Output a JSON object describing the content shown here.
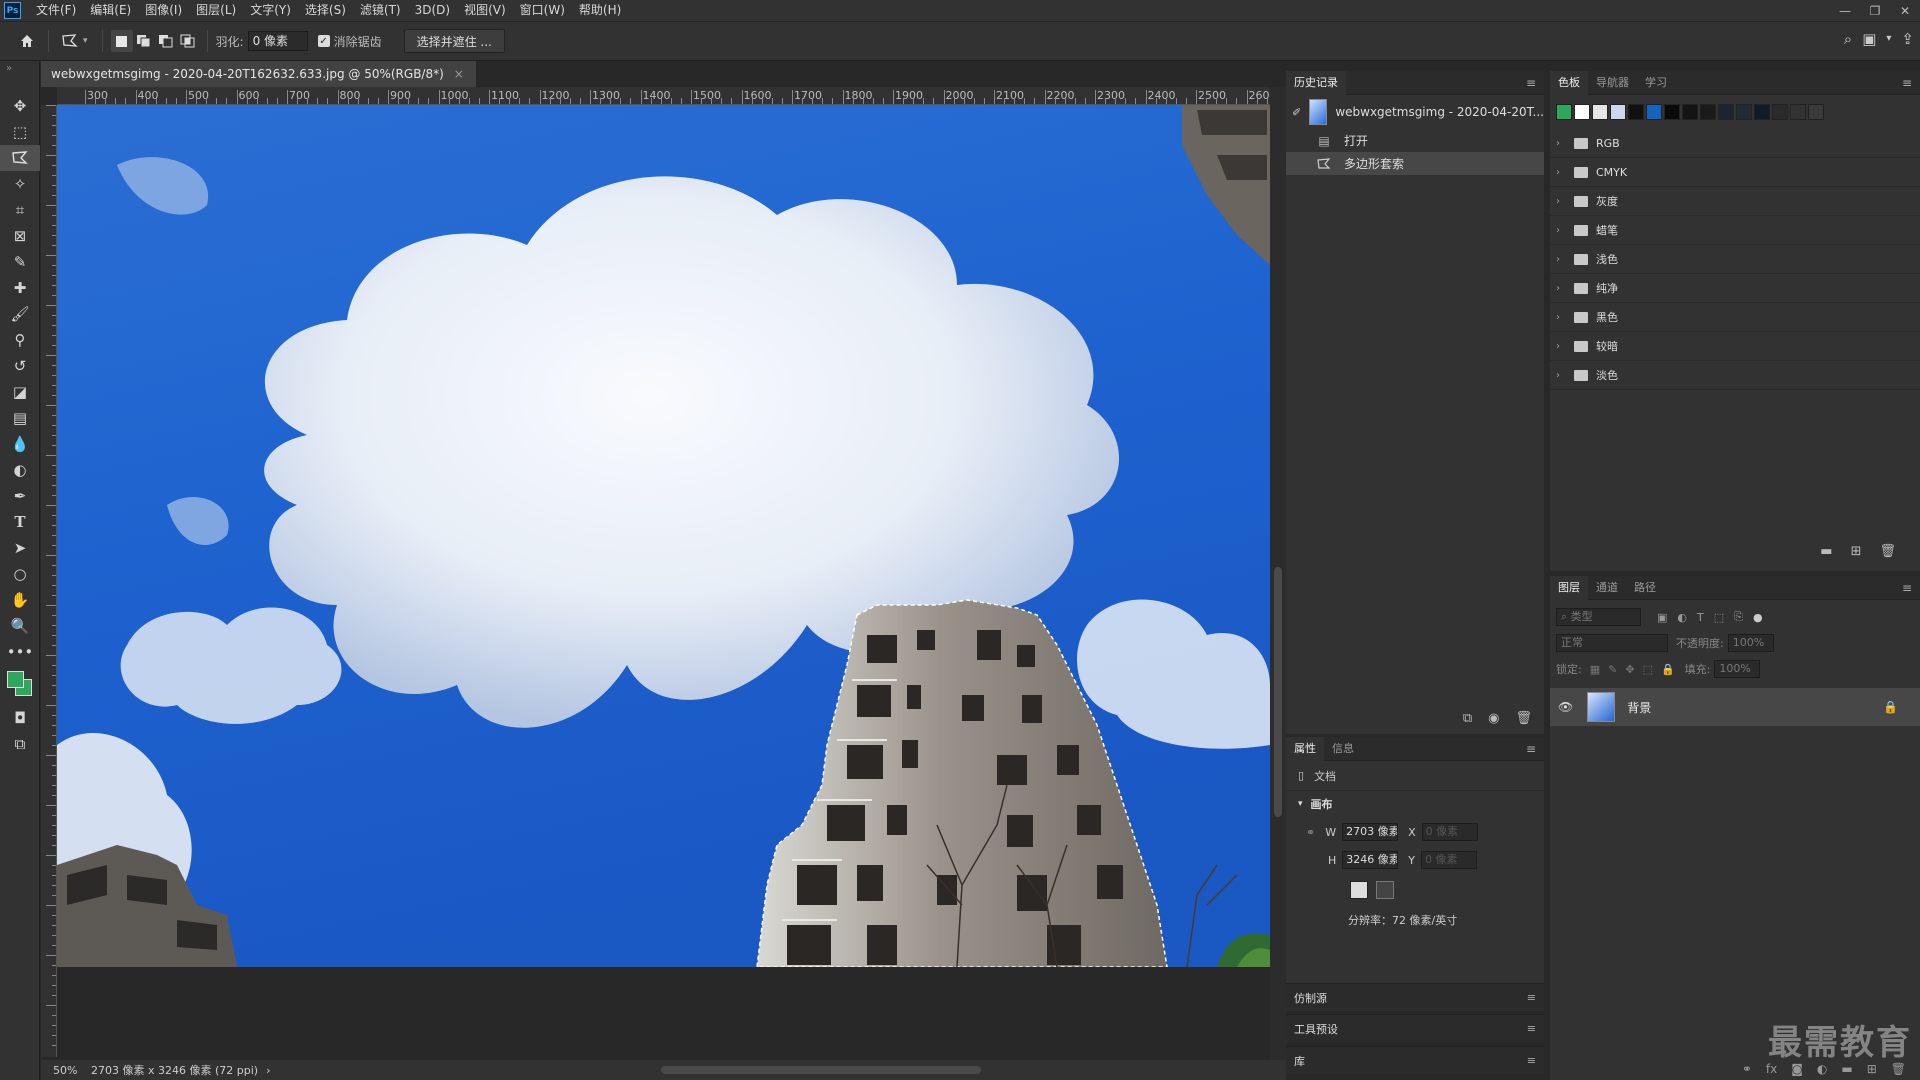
{
  "app": {
    "logo": "Ps",
    "menus": [
      "文件(F)",
      "编辑(E)",
      "图像(I)",
      "图层(L)",
      "文字(Y)",
      "选择(S)",
      "滤镜(T)",
      "3D(D)",
      "视图(V)",
      "窗口(W)",
      "帮助(H)"
    ]
  },
  "options": {
    "feather_label": "羽化:",
    "feather_value": "0 像素",
    "antialias_label": "消除锯齿",
    "select_mask_button": "选择并遮住 ..."
  },
  "document": {
    "tab_title": "webwxgetmsgimg - 2020-04-20T162632.633.jpg @ 50%(RGB/8*)",
    "tab_close": "×",
    "ruler_ticks": [
      "300",
      "400",
      "500",
      "600",
      "700",
      "800",
      "900",
      "1000",
      "1100",
      "1200",
      "1300",
      "1400",
      "1500",
      "1600",
      "1700",
      "1800",
      "1900",
      "2000",
      "2100",
      "2200",
      "2300",
      "2400",
      "2500",
      "260"
    ],
    "zoom": "50%",
    "status_info": "2703 像素 x 3246 像素 (72 ppi)",
    "status_arrow": "›"
  },
  "history": {
    "tabs": [
      "历史记录"
    ],
    "snapshot": "webwxgetmsgimg - 2020-04-20T...",
    "steps": [
      {
        "label": "打开",
        "icon": "document-icon"
      },
      {
        "label": "多边形套索",
        "icon": "polygon-lasso-icon"
      }
    ]
  },
  "properties": {
    "tabs": [
      "属性",
      "信息"
    ],
    "doc_label": "文档",
    "section": "画布",
    "w_label": "W",
    "w_value": "2703 像素",
    "h_label": "H",
    "h_value": "3246 像素",
    "x_label": "X",
    "x_value": "0 像素",
    "y_label": "Y",
    "y_value": "0 像素",
    "resolution": "分辨率：72 像素/英寸"
  },
  "mini_panels": [
    "仿制源",
    "工具预设",
    "库"
  ],
  "swatches": {
    "tabs": [
      "色板",
      "导航器",
      "学习"
    ],
    "recent_colors": [
      "#2ea65c",
      "#ffffff",
      "#e6e6e6",
      "#cdd8f0",
      "#111111",
      "#1465c0",
      "#0a0a0a",
      "#141414",
      "#1a1a1a",
      "#1d2430",
      "#202a36",
      "#0f1a2a",
      "#2a2a2a",
      "#333333",
      "#3a3a3a"
    ],
    "groups": [
      "RGB",
      "CMYK",
      "灰度",
      "蜡笔",
      "浅色",
      "纯净",
      "黑色",
      "较暗",
      "淡色"
    ]
  },
  "layers": {
    "tabs": [
      "图层",
      "通道",
      "路径"
    ],
    "filter_placeholder": "类型",
    "blend_mode": "正常",
    "opacity_label": "不透明度:",
    "opacity_value": "100%",
    "lock_label": "锁定:",
    "fill_label": "填充:",
    "fill_value": "100%",
    "layer_name": "背景"
  },
  "watermark": "最需教育",
  "colors": {
    "foreground": "#2ea65c",
    "background": "#2ea65c"
  }
}
